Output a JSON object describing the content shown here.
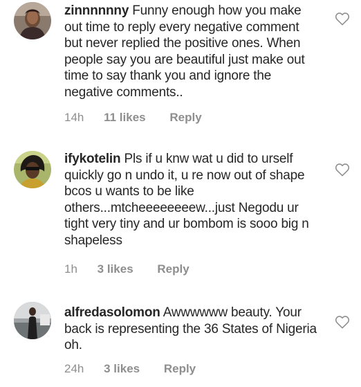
{
  "comments": [
    {
      "username": "zinnnnnny",
      "text": "Funny enough how you make out time to reply every negative comment but never replied the positive ones. When people say you are beautiful just make out time to say thank you and ignore the negative comments..",
      "time": "14h",
      "likes": "11 likes",
      "reply": "Reply"
    },
    {
      "username": "ifykotelin",
      "text": "Pls if u knw wat u did to urself quickly go n undo it, u re now out of shape bcos u wants to be like others...mtcheeeeeeeew...just Negodu ur tight very tiny and ur bombom is sooo big n shapeless",
      "time": "1h",
      "likes": "3 likes",
      "reply": "Reply"
    },
    {
      "username": "alfredasolomon",
      "text": "Awwwwww beauty. Your back is representing the 36 States of Nigeria oh.",
      "time": "24h",
      "likes": "3 likes",
      "reply": "Reply"
    }
  ],
  "icons": {
    "avatar": "avatar",
    "like": "heart-outline-icon"
  },
  "colors": {
    "text": "#262626",
    "meta": "#8e8e8e",
    "heart": "#8e8e8e"
  }
}
